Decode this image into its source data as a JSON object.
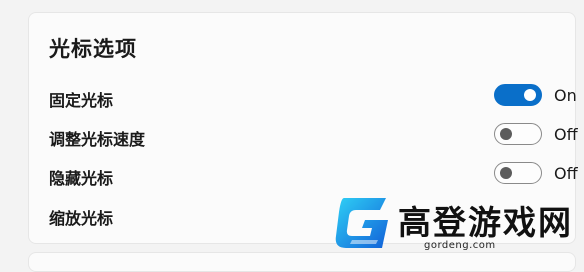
{
  "section": {
    "title": "光标选项"
  },
  "settings": [
    {
      "label": "固定光标",
      "state": "On",
      "enabled": true
    },
    {
      "label": "调整光标速度",
      "state": "Off",
      "enabled": false
    },
    {
      "label": "隐藏光标",
      "state": "Off",
      "enabled": false
    },
    {
      "label": "缩放光标"
    }
  ],
  "watermark": {
    "title": "高登游戏网",
    "url": "gordeng.com"
  },
  "colors": {
    "toggle_on": "#0a6fc9",
    "card_bg": "#fbfbfb",
    "page_bg": "#f3f3f3"
  }
}
